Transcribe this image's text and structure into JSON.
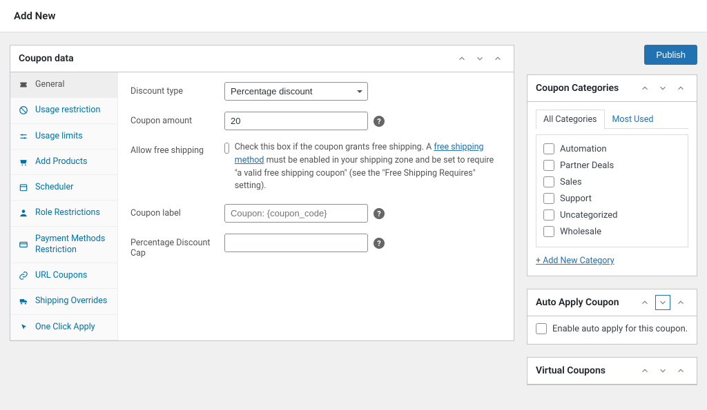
{
  "page_title": "Add New",
  "publish_label": "Publish",
  "coupon_data": {
    "title": "Coupon data",
    "tabs": [
      {
        "label": "General"
      },
      {
        "label": "Usage restriction"
      },
      {
        "label": "Usage limits"
      },
      {
        "label": "Add Products"
      },
      {
        "label": "Scheduler"
      },
      {
        "label": "Role Restrictions"
      },
      {
        "label": "Payment Methods Restriction"
      },
      {
        "label": "URL Coupons"
      },
      {
        "label": "Shipping Overrides"
      },
      {
        "label": "One Click Apply"
      }
    ],
    "fields": {
      "discount_type": {
        "label": "Discount type",
        "value": "Percentage discount"
      },
      "coupon_amount": {
        "label": "Coupon amount",
        "value": "20"
      },
      "allow_free_shipping": {
        "label": "Allow free shipping",
        "description_pre": "Check this box if the coupon grants free shipping. A ",
        "link_text": "free shipping method",
        "description_post": " must be enabled in your shipping zone and be set to require \"a valid free shipping coupon\" (see the \"Free Shipping Requires\" setting)."
      },
      "coupon_label": {
        "label": "Coupon label",
        "placeholder": "Coupon: {coupon_code}",
        "value": ""
      },
      "percentage_cap": {
        "label": "Percentage Discount Cap",
        "value": ""
      }
    }
  },
  "categories": {
    "title": "Coupon Categories",
    "tab_all": "All Categories",
    "tab_most_used": "Most Used",
    "items": [
      "Automation",
      "Partner Deals",
      "Sales",
      "Support",
      "Uncategorized",
      "Wholesale"
    ],
    "add_new": "+ Add New Category"
  },
  "auto_apply": {
    "title": "Auto Apply Coupon",
    "checkbox_label": "Enable auto apply for this coupon."
  },
  "virtual_coupons": {
    "title": "Virtual Coupons"
  }
}
